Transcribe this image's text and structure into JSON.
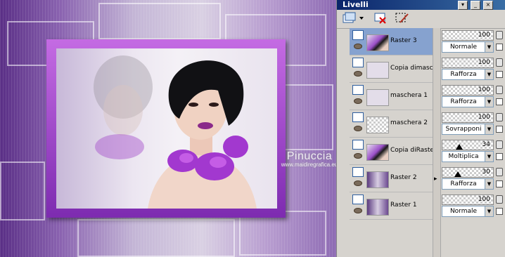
{
  "panel": {
    "title": "Livelli",
    "layers": [
      {
        "name": "Raster 3",
        "opacity": "100",
        "opacity_value": 100,
        "blend": "Normale",
        "selected": true,
        "thumb": "portrait"
      },
      {
        "name": "Copia dimaschera",
        "opacity": "100",
        "opacity_value": 100,
        "blend": "Rafforza",
        "selected": false,
        "thumb": "pale"
      },
      {
        "name": "maschera 1",
        "opacity": "100",
        "opacity_value": 100,
        "blend": "Rafforza",
        "selected": false,
        "thumb": "pale"
      },
      {
        "name": "maschera 2",
        "opacity": "100",
        "opacity_value": 100,
        "blend": "Sovrapponi",
        "selected": false,
        "thumb": "checker"
      },
      {
        "name": "Copia diRaster",
        "opacity": "34",
        "opacity_value": 34,
        "blend": "Moltiplica",
        "selected": false,
        "thumb": "portrait"
      },
      {
        "name": "Raster 2",
        "opacity": "30",
        "opacity_value": 30,
        "blend": "Rafforza",
        "selected": false,
        "thumb": "gradient"
      },
      {
        "name": "Raster 1",
        "opacity": "100",
        "opacity_value": 100,
        "blend": "Normale",
        "selected": false,
        "thumb": "gradient"
      }
    ]
  },
  "canvas": {
    "watermark_line1": "Pinuccia",
    "watermark_line2": "www.maidiregrafica.eu"
  },
  "colors": {
    "frame": "#a442d6",
    "selection": "#86a2cf",
    "titlebar": "#0a246a"
  }
}
